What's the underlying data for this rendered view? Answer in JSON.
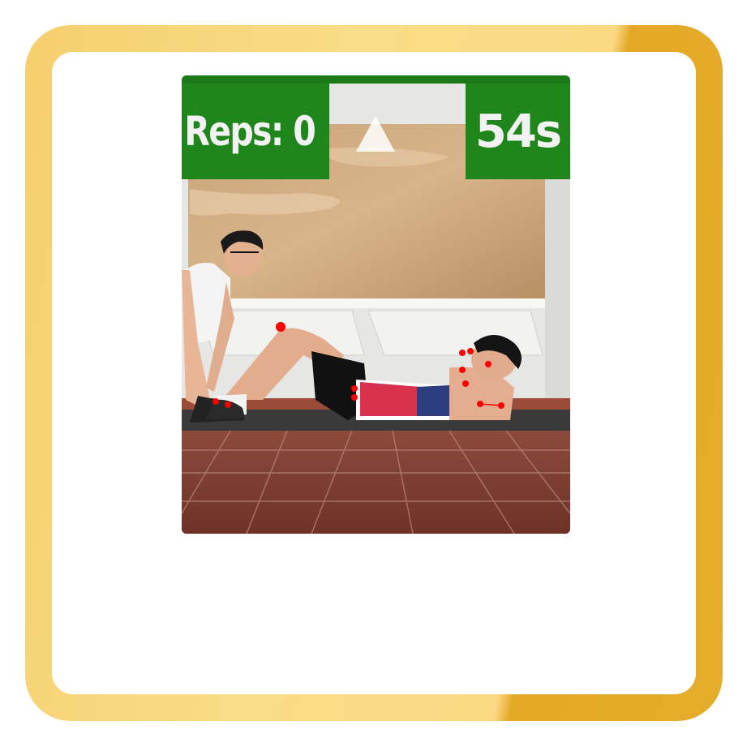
{
  "hud": {
    "reps_label": "Reps: 0",
    "timer_label": "54s"
  },
  "colors": {
    "frame_gold": "#f6cf6e",
    "frame_gold_dark": "#e3a826",
    "hud_green": "#1f861b",
    "keypoint_red": "#ff0000"
  },
  "icons": {
    "direction_indicator": "up-triangle-icon"
  }
}
